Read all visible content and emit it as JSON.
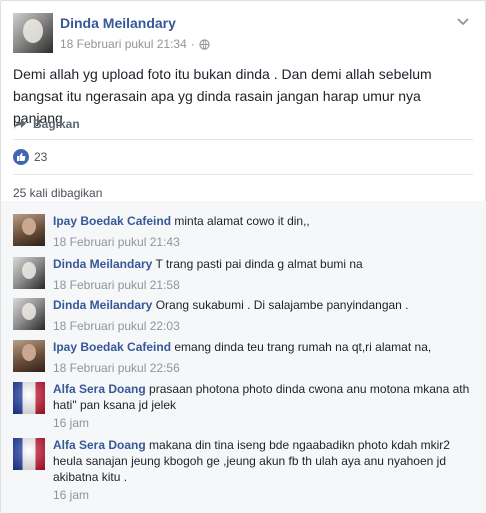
{
  "post": {
    "author": "Dinda Meilandary",
    "timestamp": "18 Februari pukul 21:34",
    "separator": "·",
    "privacy_icon": "globe-icon",
    "menu_icon": "chevron-down-icon",
    "text": "Demi allah yg upload foto itu bukan dinda . Dan demi allah sebelum bangsat itu ngerasain apa yg dinda rasain jangan harap umur nya panjang"
  },
  "share": {
    "icon": "share-arrow-icon",
    "label": "Bagikan"
  },
  "reactions": {
    "icon": "like-icon",
    "count": "23"
  },
  "shares_count": "25 kali dibagikan",
  "comments": [
    {
      "author": "Ipay Boedak Cafeind",
      "text": "minta alamat cowo it din,,",
      "time": "18 Februari pukul 21:43"
    },
    {
      "author": "Dinda Meilandary",
      "text": "T trang pasti pai dinda g almat bumi na",
      "time": "18 Februari pukul 21:58"
    },
    {
      "author": "Dinda Meilandary",
      "text": "Orang sukabumi . Di salajambe panyindangan .",
      "time": "18 Februari pukul 22:03"
    },
    {
      "author": "Ipay Boedak Cafeind",
      "text": "emang dinda teu trang rumah na qt,ri alamat na,",
      "time": "18 Februari pukul 22:56"
    },
    {
      "author": "Alfa Sera Doang",
      "text": "prasaan photona photo dinda cwona anu motona mkana ath hati\" pan ksana jd jelek",
      "time": "16 jam"
    },
    {
      "author": "Alfa Sera Doang",
      "text": "makana din tina iseng bde ngaabadikn photo kdah mkir2 heula sanajan jeung kbogoh ge ,jeung akun fb th ulah aya anu nyahoen jd akibatna kitu .",
      "time": "16 jam"
    }
  ],
  "colors": {
    "link": "#365899",
    "meta": "#90949c",
    "accent": "#4267b2",
    "comments_bg": "#f6f7f9"
  }
}
